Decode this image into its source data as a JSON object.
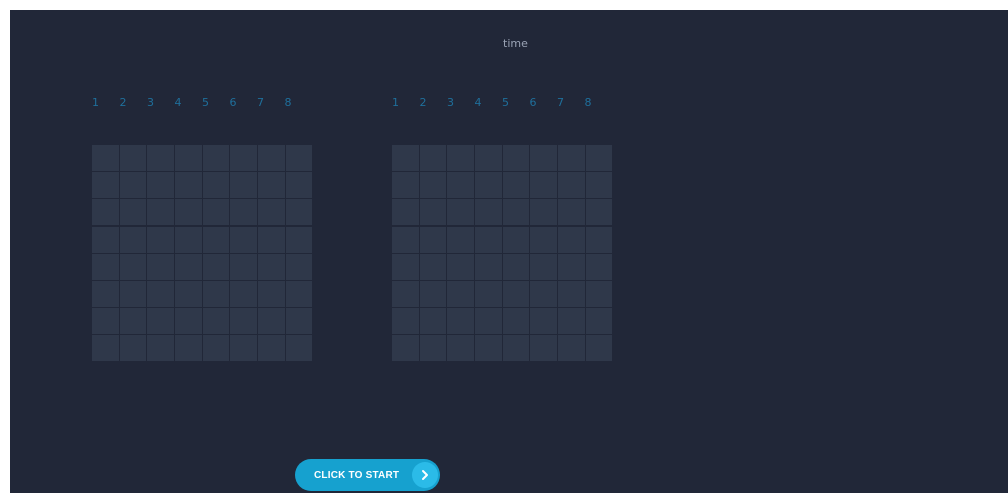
{
  "header": {
    "time_label": "time"
  },
  "grids": {
    "left": {
      "column_numbers": [
        "1",
        "2",
        "3",
        "4",
        "5",
        "6",
        "7",
        "8"
      ],
      "rows": 8,
      "cols": 8
    },
    "right": {
      "column_numbers": [
        "1",
        "2",
        "3",
        "4",
        "5",
        "6",
        "7",
        "8"
      ],
      "rows": 8,
      "cols": 8
    }
  },
  "start_button": {
    "label": "CLICK TO START",
    "icon": "chevron-right-icon"
  },
  "colors": {
    "background": "#212738",
    "cell": "#2f384a",
    "column_number": "#1f6f9b",
    "button": "#16a1cf",
    "button_icon_bg": "#2bbbe8"
  }
}
